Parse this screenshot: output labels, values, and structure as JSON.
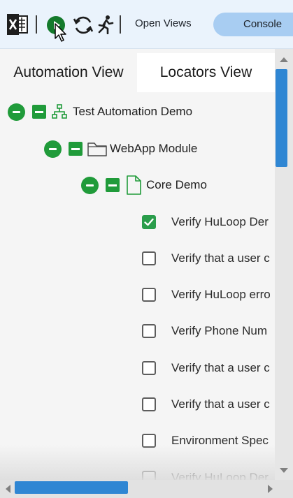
{
  "toolbar": {
    "excel_icon": "excel-export-icon",
    "play_icon": "play-icon",
    "refresh_icon": "refresh-icon",
    "run_icon": "running-person-icon",
    "open_views_label": "Open Views",
    "console_label": "Console"
  },
  "tabs": [
    {
      "label": "Automation View",
      "active": false
    },
    {
      "label": "Locators View",
      "active": true
    }
  ],
  "tree": {
    "root": {
      "label": "Test Automation Demo",
      "icon": "hierarchy-icon"
    },
    "module": {
      "label": "WebApp Module",
      "icon": "folder-icon"
    },
    "suite": {
      "label": "Core Demo",
      "icon": "file-icon"
    },
    "tests": [
      {
        "label": "Verify HuLoop Der",
        "checked": true
      },
      {
        "label": "Verify that a user c",
        "checked": false
      },
      {
        "label": "Verify HuLoop erro",
        "checked": false
      },
      {
        "label": "Verify Phone Num",
        "checked": false
      },
      {
        "label": "Verify that a user c",
        "checked": false
      },
      {
        "label": "Verify that a user c",
        "checked": false
      },
      {
        "label": "Environment Spec",
        "checked": false
      },
      {
        "label": "Verify HuLoop Der",
        "checked": false
      }
    ]
  },
  "colors": {
    "toolbar_bg": "#eaf3fc",
    "accent_green": "#209b3a",
    "console_bg": "#a8cdf2",
    "scroll_thumb": "#2f86d3"
  }
}
